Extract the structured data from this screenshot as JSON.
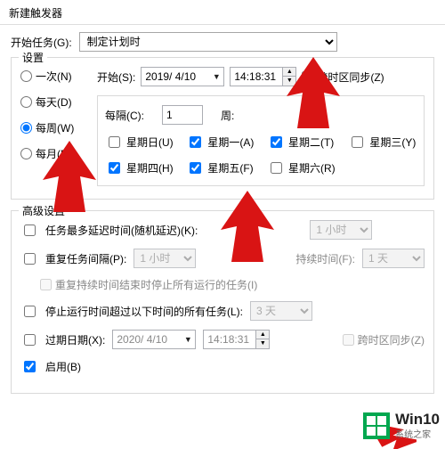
{
  "window": {
    "title": "新建触发器"
  },
  "startTask": {
    "label": "开始任务(G):",
    "value": "制定计划时"
  },
  "settings": {
    "legend": "设置",
    "radios": {
      "once": "一次(N)",
      "daily": "每天(D)",
      "weekly": "每周(W)",
      "monthly": "每月(M)"
    },
    "startLabel": "开始(S):",
    "date": "2019/ 4/10",
    "time": "14:18:31",
    "syncTZ": "跨时区同步(Z)",
    "recurLabel": "每隔(C):",
    "recurValue": "1",
    "weekLabel": "周:",
    "days": {
      "sun": "星期日(U)",
      "mon": "星期一(A)",
      "tue": "星期二(T)",
      "wed": "星期三(Y)",
      "thu": "星期四(H)",
      "fri": "星期五(F)",
      "sat": "星期六(R)"
    }
  },
  "advanced": {
    "legend": "高级设置",
    "delay": {
      "label": "任务最多延迟时间(随机延迟)(K):",
      "value": "1 小时"
    },
    "repeat": {
      "label": "重复任务间隔(P):",
      "value": "1 小时",
      "durationLabel": "持续时间(F):",
      "durationValue": "1 天"
    },
    "repeatSub": "重复持续时间结束时停止所有运行的任务(I)",
    "stopAfter": {
      "label": "停止运行时间超过以下时间的所有任务(L):",
      "value": "3 天"
    },
    "expire": {
      "label": "过期日期(X):",
      "date": "2020/ 4/10",
      "time": "14:18:31",
      "syncTZ": "跨时区同步(Z)"
    },
    "enable": "启用(B)"
  },
  "watermark": {
    "line1": "Win10",
    "line2": "系统之家"
  }
}
